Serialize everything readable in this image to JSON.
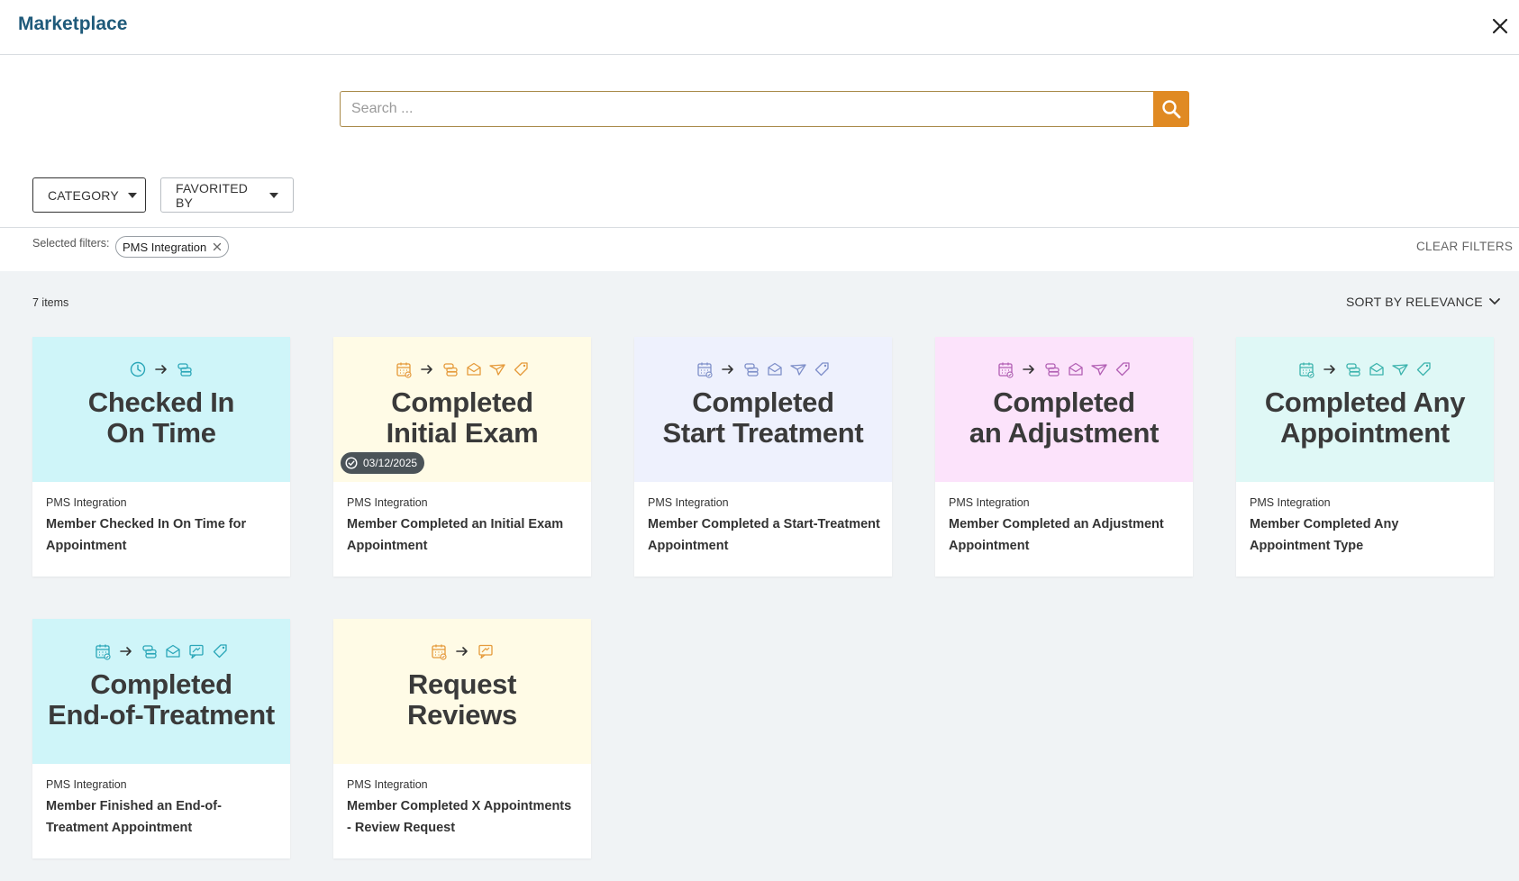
{
  "header": {
    "title": "Marketplace",
    "close_icon": "close-icon"
  },
  "search": {
    "placeholder": "Search ...",
    "value": "",
    "button_icon": "search-icon",
    "accent": "#e08a23"
  },
  "filters": {
    "buttons": [
      {
        "label": "CATEGORY",
        "active": true
      },
      {
        "label": "FAVORITED BY",
        "active": false
      }
    ],
    "selected_label": "Selected filters:",
    "chips": [
      {
        "label": "PMS Integration"
      }
    ],
    "clear_label": "CLEAR FILTERS"
  },
  "results": {
    "count_label": "7 items",
    "sort_label": "SORT BY RELEVANCE"
  },
  "cards": [
    {
      "headline_1": "Checked In",
      "headline_2": "On Time",
      "category": "PMS Integration",
      "title": "Member Checked In On Time for Appointment",
      "banner_color": "#cff5f9",
      "icon_color": "#2aa6b8",
      "icons": [
        "clock-icon",
        "arrow-right-icon",
        "coins-icon"
      ],
      "badge": ""
    },
    {
      "headline_1": "Completed",
      "headline_2": "Initial Exam",
      "category": "PMS Integration",
      "title": "Member Completed an Initial Exam Appointment",
      "banner_color": "#fffbe6",
      "icon_color": "#e59a3a",
      "icons": [
        "calendar-check-icon",
        "arrow-right-icon",
        "coins-icon",
        "mail-icon",
        "paper-plane-icon",
        "tag-icon"
      ],
      "badge": "03/12/2025"
    },
    {
      "headline_1": "Completed",
      "headline_2": "Start Treatment",
      "category": "PMS Integration",
      "title": "Member Completed a Start-Treatment Appointment",
      "banner_color": "#eef1fd",
      "icon_color": "#7e8fc9",
      "icons": [
        "calendar-check-icon",
        "arrow-right-icon",
        "coins-icon",
        "mail-icon",
        "paper-plane-icon",
        "tag-icon"
      ],
      "badge": ""
    },
    {
      "headline_1": "Completed",
      "headline_2": "an Adjustment",
      "category": "PMS Integration",
      "title": "Member Completed an Adjustment Appointment",
      "banner_color": "#fce3fb",
      "icon_color": "#b25fb4",
      "icons": [
        "calendar-check-icon",
        "arrow-right-icon",
        "coins-icon",
        "mail-icon",
        "paper-plane-icon",
        "tag-icon"
      ],
      "badge": ""
    },
    {
      "headline_1": "Completed Any",
      "headline_2": "Appointment",
      "category": "PMS Integration",
      "title": "Member Completed Any Appointment Type",
      "banner_color": "#dff8f6",
      "icon_color": "#3bb3ad",
      "icons": [
        "calendar-check-icon",
        "arrow-right-icon",
        "coins-icon",
        "mail-icon",
        "paper-plane-icon",
        "tag-icon"
      ],
      "badge": ""
    },
    {
      "headline_1": "Completed",
      "headline_2": "End-of-Treatment",
      "category": "PMS Integration",
      "title": "Member Finished an End-of-Treatment Appointment",
      "banner_color": "#cff5f9",
      "icon_color": "#2aa6b8",
      "icons": [
        "calendar-check-icon",
        "arrow-right-icon",
        "coins-icon",
        "mail-icon",
        "review-icon",
        "tag-icon"
      ],
      "badge": ""
    },
    {
      "headline_1": "Request",
      "headline_2": "Reviews",
      "category": "PMS Integration",
      "title": "Member Completed X Appointments - Review Request",
      "banner_color": "#fffbe6",
      "icon_color": "#e59a3a",
      "icons": [
        "calendar-check-icon",
        "arrow-right-icon",
        "review-icon"
      ],
      "badge": ""
    }
  ]
}
